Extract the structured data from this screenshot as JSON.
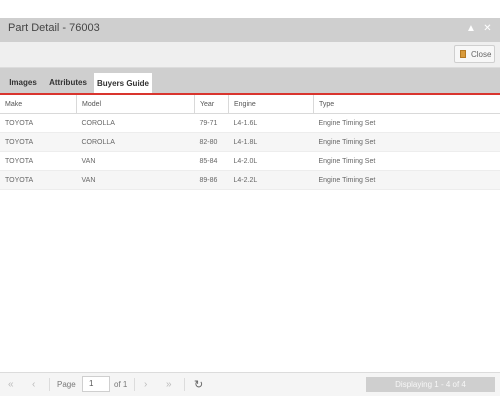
{
  "window": {
    "title": "Part Detail - 76003"
  },
  "toolbar": {
    "close_label": "Close"
  },
  "tabs": [
    {
      "label": "Images"
    },
    {
      "label": "Attributes"
    },
    {
      "label": "Buyers Guide"
    }
  ],
  "grid": {
    "columns": [
      "Make",
      "Model",
      "Year",
      "Engine",
      "Type"
    ],
    "rows": [
      [
        "TOYOTA",
        "COROLLA",
        "79-71",
        "L4-1.6L",
        "Engine Timing Set"
      ],
      [
        "TOYOTA",
        "COROLLA",
        "82-80",
        "L4-1.8L",
        "Engine Timing Set"
      ],
      [
        "TOYOTA",
        "VAN",
        "85-84",
        "L4-2.0L",
        "Engine Timing Set"
      ],
      [
        "TOYOTA",
        "VAN",
        "89-86",
        "L4-2.2L",
        "Engine Timing Set"
      ]
    ]
  },
  "pager": {
    "page_label": "Page",
    "page_value": "1",
    "of_label": "of 1",
    "displaying": "Displaying 1 - 4 of 4"
  },
  "colors": {
    "accent_red": "#d9352e",
    "titlebar": "#cfcfcf"
  }
}
